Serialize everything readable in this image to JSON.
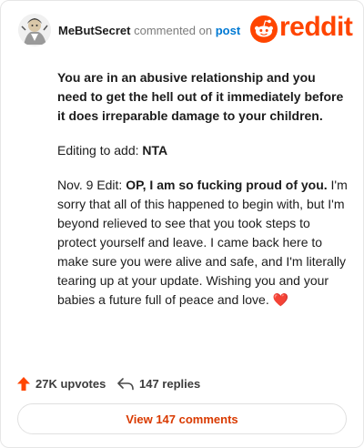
{
  "header": {
    "username": "MeButSecret",
    "action": "commented on",
    "post_link": "post",
    "logo_text": "reddit"
  },
  "comment": {
    "p1": "You are in an abusive relationship and you need to get the hell out of it immediately before it does irreparable damage to your children.",
    "p2_prefix": "Editing to add: ",
    "p2_strong": "NTA",
    "p3_prefix": "Nov. 9 Edit: ",
    "p3_strong": "OP, I am so fucking proud of you.",
    "p3_rest": " I'm sorry that all of this happened to begin with, but I'm beyond relieved to see that you took steps to protect yourself and leave. I came back here to make sure you were alive and safe, and I'm literally tearing up at your update. Wishing you and your babies a future full of peace and love. ",
    "heart": "❤️"
  },
  "footer": {
    "upvotes": "27K upvotes",
    "replies": "147 replies",
    "view_comments": "View 147 comments"
  },
  "colors": {
    "brand": "#ff4500",
    "upvote": "#ff4500",
    "link": "#0079d3",
    "view_button_text": "#d93a00"
  },
  "icons": {
    "avatar": "user-avatar",
    "logo": "reddit-snoo-logo",
    "upvote": "upvote-arrow-icon",
    "reply": "reply-arrow-icon"
  }
}
